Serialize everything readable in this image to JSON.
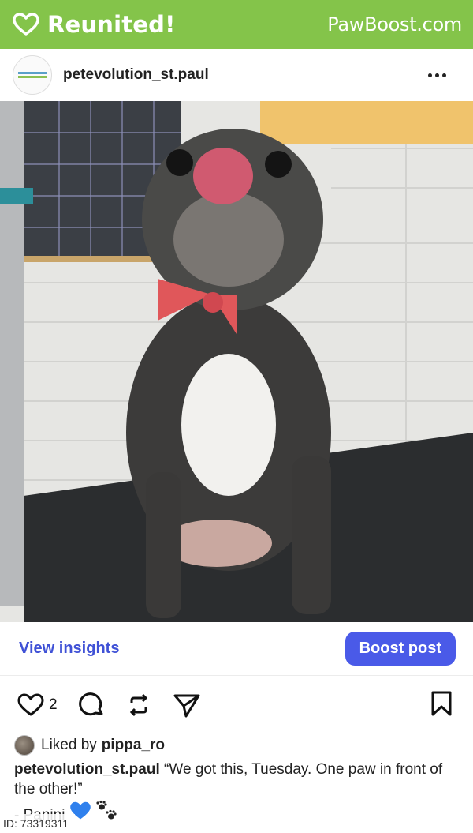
{
  "banner": {
    "title": "Reunited!",
    "brand": "PawBoost.com",
    "color": "#84c44a"
  },
  "post": {
    "username": "petevolution_st.paul",
    "avatar_icon": "petevolution-logo-icon",
    "more_icon": "more-dots-icon",
    "photo_description_icon": "dog-photo"
  },
  "insights": {
    "view_label": "View insights",
    "boost_label": "Boost post",
    "boost_color": "#4a5ae8"
  },
  "actions": {
    "like_count": "2",
    "icons": [
      "heart-icon",
      "comment-icon",
      "repost-icon",
      "send-icon",
      "bookmark-icon"
    ]
  },
  "liked_by": {
    "prefix": "Liked by",
    "user": "pippa_ro"
  },
  "caption": {
    "user": "petevolution_st.paul",
    "text": "“We got this, Tuesday. One paw in front of the other!”",
    "signoff": "- Panini"
  },
  "footer": {
    "id_label": "ID: 73319311"
  }
}
